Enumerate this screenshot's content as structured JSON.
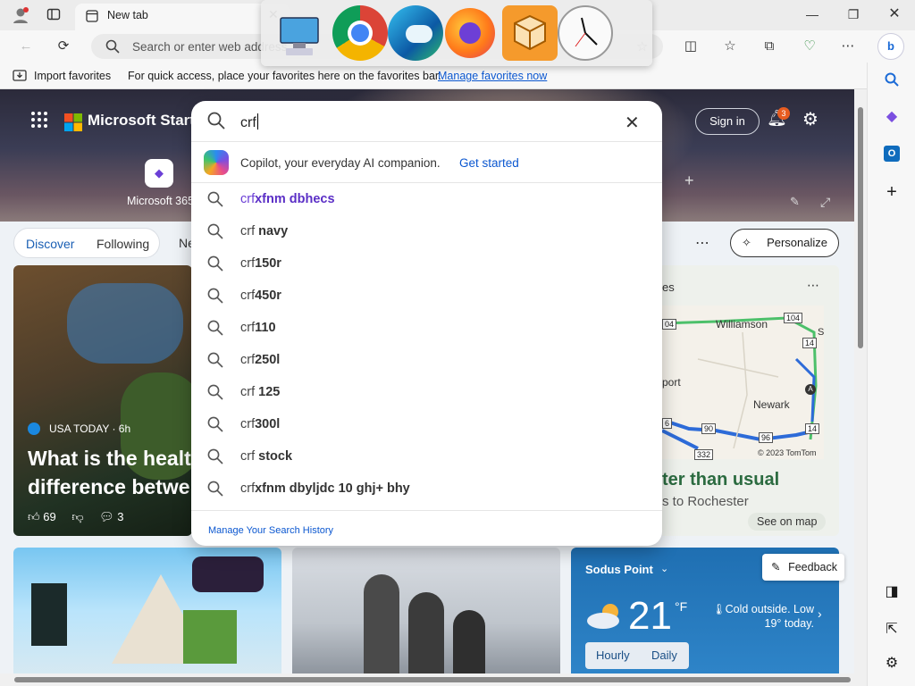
{
  "browser": {
    "tab_title": "New tab",
    "address_placeholder": "Search or enter web address",
    "favbar": {
      "import": "Import favorites",
      "hint": "For quick access, place your favorites here on the favorites bar.",
      "manage_link": "Manage favorites now"
    }
  },
  "header": {
    "brand": "Microsoft Start",
    "signin": "Sign in",
    "notif_count": "3",
    "m365_label": "Microsoft 365"
  },
  "feed": {
    "tabs": [
      "Discover",
      "Following",
      "Ne"
    ],
    "personalize": "Personalize"
  },
  "main_card": {
    "source": "USA TODAY · 6h",
    "headline": "What is the healt difference betwe",
    "likes": "69",
    "comments": "3"
  },
  "traffic": {
    "label": "es",
    "headline": "ter than usual",
    "sub": "s to Rochester",
    "see_map": "See on map",
    "map_labels": {
      "williamson": "Williamson",
      "port": "port",
      "newark": "Newark",
      "copyright": "© 2023 TomTom",
      "r104a": "104",
      "r104b": "04",
      "r14a": "14",
      "r14b": "14",
      "r90": "90",
      "r96": "96",
      "r332": "332",
      "r6": "6",
      "s": "S",
      "a": "A"
    }
  },
  "weather": {
    "location": "Sodus Point",
    "temp": "21",
    "unit": "°F",
    "desc": "Cold outside. Low 19° today.",
    "tabs": [
      "Hourly",
      "Daily"
    ]
  },
  "feedback": "Feedback",
  "search": {
    "query": "crf",
    "copilot_text": "Copilot, your everyday AI companion.",
    "copilot_link": "Get started",
    "suggestions": [
      {
        "prefix": "crf",
        "bold": "xfnm dbhecs"
      },
      {
        "prefix": "crf ",
        "bold": "navy"
      },
      {
        "prefix": "crf",
        "bold": "150r"
      },
      {
        "prefix": "crf",
        "bold": "450r"
      },
      {
        "prefix": "crf",
        "bold": "110"
      },
      {
        "prefix": "crf",
        "bold": "250l"
      },
      {
        "prefix": "crf ",
        "bold": "125"
      },
      {
        "prefix": "crf",
        "bold": "300l"
      },
      {
        "prefix": "crf ",
        "bold": "stock"
      },
      {
        "prefix": "crf",
        "bold": "xfnm dbyljdc 10 ghj+ bhy"
      }
    ],
    "manage_history": "Manage Your Search History"
  },
  "colors": {
    "accent": "#0b57d0",
    "copilot_suggestion": "#6b3fd6",
    "weather_bg": "#1f6fb2",
    "badge": "#e75c20"
  }
}
